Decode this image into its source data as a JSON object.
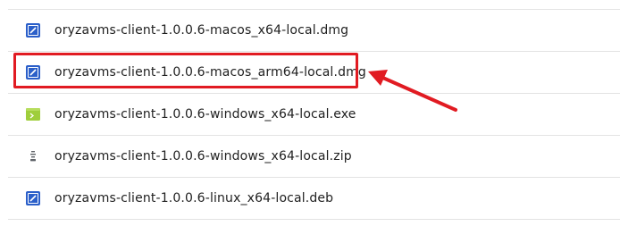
{
  "files": [
    {
      "name": "oryzavms-client-1.0.0.6-macos_x64-local.dmg",
      "icon": "disk-image-icon"
    },
    {
      "name": "oryzavms-client-1.0.0.6-macos_arm64-local.dmg",
      "icon": "disk-image-icon"
    },
    {
      "name": "oryzavms-client-1.0.0.6-windows_x64-local.exe",
      "icon": "executable-icon"
    },
    {
      "name": "oryzavms-client-1.0.0.6-windows_x64-local.zip",
      "icon": "zip-archive-icon"
    },
    {
      "name": "oryzavms-client-1.0.0.6-linux_x64-local.deb",
      "icon": "disk-image-icon"
    }
  ],
  "colors": {
    "highlight": "#e11b22",
    "disk_icon": "#2b5fc9",
    "exe_icon": "#9fce3b",
    "divider": "#e3e3e3"
  }
}
